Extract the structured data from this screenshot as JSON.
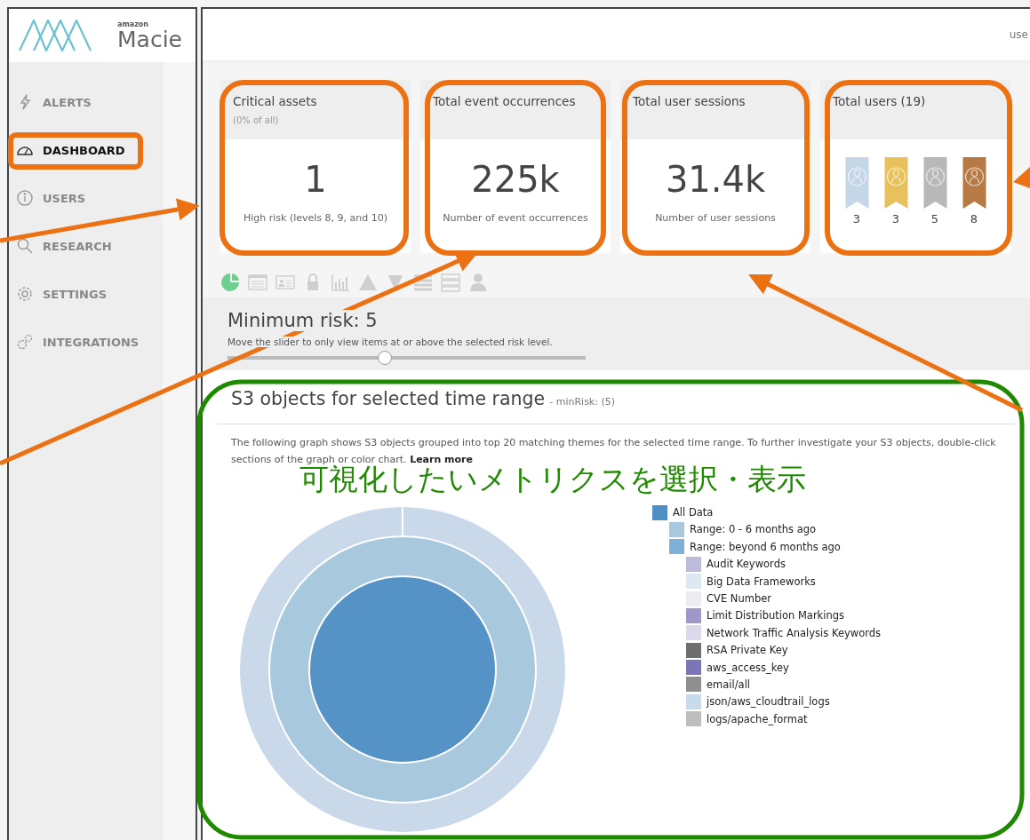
{
  "logo": {
    "brand": "amazon",
    "product": "Macie"
  },
  "nav": [
    {
      "label": "ALERTS",
      "selected": false
    },
    {
      "label": "DASHBOARD",
      "selected": true
    },
    {
      "label": "USERS",
      "selected": false
    },
    {
      "label": "RESEARCH",
      "selected": false
    },
    {
      "label": "SETTINGS",
      "selected": false
    },
    {
      "label": "INTEGRATIONS",
      "selected": false
    }
  ],
  "header": {
    "user_label": "use"
  },
  "cards": [
    {
      "kind": "metric",
      "title": "Critical assets",
      "subtitle": "(0% of all)",
      "value": "1",
      "caption": "High risk (levels 8, 9, and 10)"
    },
    {
      "kind": "metric",
      "title": "Total event occurrences",
      "value": "225k",
      "caption": "Number of event occurrences"
    },
    {
      "kind": "metric",
      "title": "Total user sessions",
      "value": "31.4k",
      "caption": "Number of user sessions"
    },
    {
      "kind": "users",
      "title": "Total users (19)",
      "groups": [
        {
          "count": "3",
          "color": "#c5d6e6"
        },
        {
          "count": "3",
          "color": "#e8c15c"
        },
        {
          "count": "5",
          "color": "#b8b8b8"
        },
        {
          "count": "8",
          "color": "#b87a45"
        }
      ]
    }
  ],
  "view_tabs": [
    {
      "selected": true
    },
    {
      "selected": false
    },
    {
      "selected": false
    },
    {
      "selected": false
    },
    {
      "selected": false
    },
    {
      "selected": false
    },
    {
      "selected": false
    },
    {
      "selected": false
    },
    {
      "selected": false
    },
    {
      "selected": false
    }
  ],
  "risk": {
    "title": "Minimum risk: 5",
    "hint": "Move the slider to only view items at or above the selected risk level.",
    "level": 0.44
  },
  "chart_panel": {
    "title": "S3 objects for selected time range",
    "subtitle": "- minRisk: (5)",
    "description": "The following graph shows S3 objects grouped into top 20 matching themes for the selected time range. To further investigate your S3 objects, double-click sections of the graph or color chart.",
    "link": "Learn more",
    "legend": [
      {
        "label": "All Data",
        "color": "#4f8fc6",
        "children": [
          {
            "label": "Range: 0 - 6 months ago",
            "color": "#a8c8de"
          },
          {
            "label": "Range: beyond 6 months ago",
            "color": "#7fb0d6",
            "children": [
              {
                "label": "Audit Keywords",
                "color": "#bcbbdc"
              },
              {
                "label": "Big Data Frameworks",
                "color": "#dde8f3"
              },
              {
                "label": "CVE Number",
                "color": "#ececf3"
              },
              {
                "label": "Limit Distribution Markings",
                "color": "#9e99c8"
              },
              {
                "label": "Network Traffic Analysis Keywords",
                "color": "#dadaea"
              },
              {
                "label": "RSA Private Key",
                "color": "#6e6e6e"
              },
              {
                "label": "aws_access_key",
                "color": "#7b76b6"
              },
              {
                "label": "email/all",
                "color": "#8f8f8f"
              },
              {
                "label": "json/aws_cloudtrail_logs",
                "color": "#c9daeb"
              },
              {
                "label": "logs/apache_format",
                "color": "#bdbdbd"
              }
            ]
          }
        ]
      }
    ]
  },
  "annotation": {
    "caption": "可視化したいメトリクスを選択・表示"
  }
}
